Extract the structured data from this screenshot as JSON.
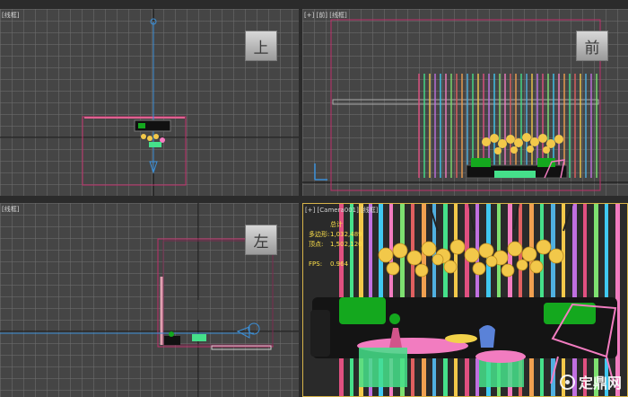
{
  "viewports": {
    "top": {
      "label": "[线框]",
      "cube": "上"
    },
    "front": {
      "label": "[+] [前] [线框]",
      "cube": "前"
    },
    "left": {
      "label": "[线框]",
      "cube": "左"
    },
    "camera": {
      "label": "[+] [Camera001] [线框]",
      "stats": {
        "total_label": "总计",
        "polys_label": "多边形:",
        "polys_value": "1,032,489",
        "verts_label": "顶点:",
        "verts_value": "1,502,120",
        "fps_label": "FPS:",
        "fps_value": "0.964"
      }
    }
  },
  "watermark": {
    "text": "定鼎网"
  },
  "colors": {
    "grid": "#6e6e6e",
    "axis": "#111111",
    "bounding_box": "#c0306a",
    "camera_line": "#3a8fd8",
    "stats_text": "#ffe24b",
    "active_border": "#d7b44a",
    "flowers": "#f2c84a",
    "sofa_cushion": "#12a01e",
    "chair": "#f27cc0",
    "table": "#45e08a"
  },
  "icons": [
    "viewcube-top",
    "viewcube-front",
    "viewcube-left",
    "watermark-logo-icon"
  ]
}
